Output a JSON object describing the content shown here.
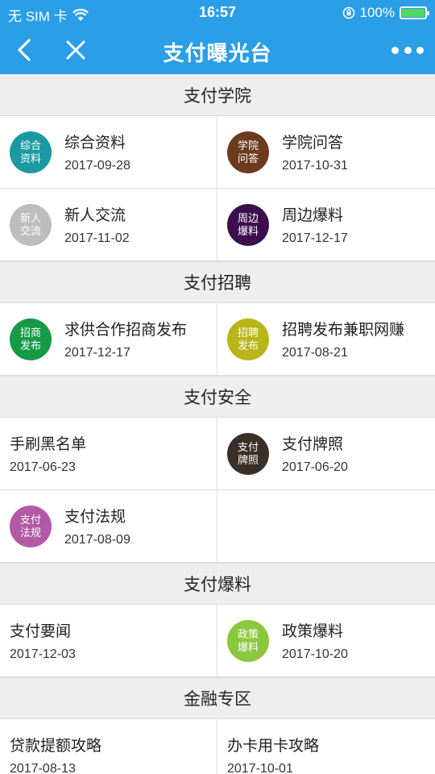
{
  "status": {
    "carrier": "无 SIM 卡",
    "time": "16:57",
    "battery": "100%",
    "battery_level": 1.0
  },
  "nav": {
    "title": "支付曝光台"
  },
  "sections": [
    {
      "title": "支付学院",
      "items": [
        {
          "title": "综合资料",
          "date": "2017-09-28",
          "icon_label": "综合资料",
          "icon_color": "#1a9aa0"
        },
        {
          "title": "学院问答",
          "date": "2017-10-31",
          "icon_label": "学院问答",
          "icon_color": "#6b3a1f"
        },
        {
          "title": "新人交流",
          "date": "2017-11-02",
          "icon_label": "新人交流",
          "icon_color": "#bdbdbd"
        },
        {
          "title": "周边爆料",
          "date": "2017-12-17",
          "icon_label": "周边爆料",
          "icon_color": "#3b0f4d"
        }
      ]
    },
    {
      "title": "支付招聘",
      "items": [
        {
          "title": "求供合作招商发布",
          "date": "2017-12-17",
          "icon_label": "招商发布",
          "icon_color": "#169a47"
        },
        {
          "title": "招聘发布兼职网赚",
          "date": "2017-08-21",
          "icon_label": "招聘发布",
          "icon_color": "#b8b51a"
        }
      ]
    },
    {
      "title": "支付安全",
      "items": [
        {
          "title": "手刷黑名单",
          "date": "2017-06-23",
          "icon_label": "",
          "icon_color": ""
        },
        {
          "title": "支付牌照",
          "date": "2017-06-20",
          "icon_label": "支付牌照",
          "icon_color": "#3a302a"
        },
        {
          "title": "支付法规",
          "date": "2017-08-09",
          "icon_label": "支付法规",
          "icon_color": "#b25aa5"
        }
      ]
    },
    {
      "title": "支付爆料",
      "items": [
        {
          "title": "支付要闻",
          "date": "2017-12-03",
          "icon_label": "",
          "icon_color": ""
        },
        {
          "title": "政策爆料",
          "date": "2017-10-20",
          "icon_label": "政策爆料",
          "icon_color": "#8dc63f"
        }
      ]
    },
    {
      "title": "金融专区",
      "items": [
        {
          "title": "贷款提额攻略",
          "date": "2017-08-13",
          "icon_label": "",
          "icon_color": ""
        },
        {
          "title": "办卡用卡攻略",
          "date": "2017-10-01",
          "icon_label": "",
          "icon_color": "#e0205a"
        }
      ]
    }
  ]
}
